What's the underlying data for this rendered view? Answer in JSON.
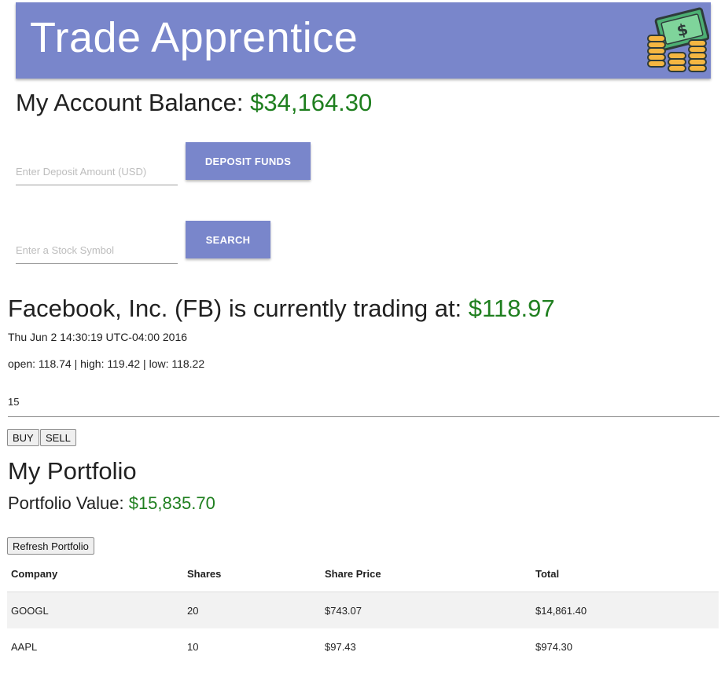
{
  "header": {
    "title": "Trade Apprentice",
    "logo_icon": "money-coins-icon",
    "background_color": "#7986cb"
  },
  "account": {
    "label": "My Account Balance:",
    "balance": "$34,164.30",
    "value_color": "#1f7f1f"
  },
  "deposit": {
    "placeholder": "Enter Deposit Amount (USD)",
    "value": "",
    "button_label": "DEPOSIT FUNDS"
  },
  "search": {
    "placeholder": "Enter a Stock Symbol",
    "value": "",
    "button_label": "SEARCH"
  },
  "quote": {
    "headline": "Facebook, Inc. (FB) is currently trading at:",
    "price": "$118.97",
    "timestamp": "Thu Jun 2 14:30:19 UTC-04:00 2016",
    "ohl": "open: 118.74 | high: 119.42 | low: 118.22",
    "quantity": "15",
    "buy_label": "BUY",
    "sell_label": "SELL"
  },
  "portfolio": {
    "title": "My Portfolio",
    "value_label": "Portfolio Value:",
    "value": "$15,835.70",
    "refresh_label": "Refresh Portfolio",
    "columns": [
      "Company",
      "Shares",
      "Share Price",
      "Total"
    ],
    "rows": [
      [
        "GOOGL",
        "20",
        "$743.07",
        "$14,861.40"
      ],
      [
        "AAPL",
        "10",
        "$97.43",
        "$974.30"
      ]
    ]
  }
}
